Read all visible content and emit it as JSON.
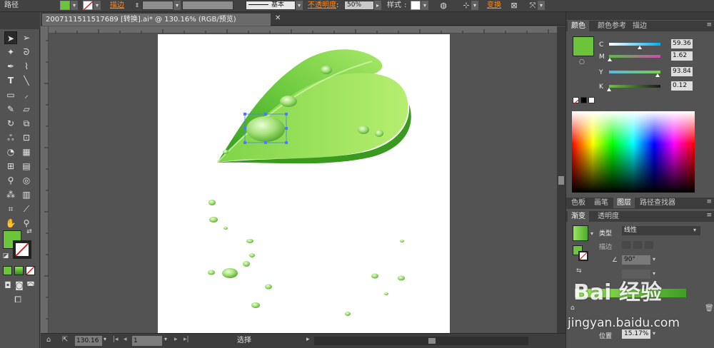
{
  "control_bar": {
    "object_type": "路径",
    "fill_color": "#6cc43a",
    "stroke_label": "描边",
    "brush_label": "基本",
    "opacity_label": "不透明度",
    "opacity_value": "50%",
    "style_label": "样式",
    "transform_label": "变换"
  },
  "document": {
    "tab_title": "2007111511517689 [转换].ai* @ 130.16% (RGB/预览)",
    "zoom_value": "130.16",
    "page_value": "1",
    "status_mode": "选择"
  },
  "color_panel": {
    "tabs": [
      "颜色",
      "颜色参考",
      "描边"
    ],
    "channels": [
      {
        "label": "C",
        "value": "59.36",
        "fraction": 0.594
      },
      {
        "label": "M",
        "value": "1.62",
        "fraction": 0.016
      },
      {
        "label": "Y",
        "value": "93.84",
        "fraction": 0.938
      },
      {
        "label": "K",
        "value": "0.12",
        "fraction": 0.001
      }
    ],
    "current_color": "#6cc43a"
  },
  "layers_tabs": [
    "色板",
    "画笔",
    "图层",
    "路径查找器"
  ],
  "gradient_panel": {
    "tabs": [
      "渐变",
      "透明度"
    ],
    "type_label": "类型",
    "type_value": "线性",
    "stroke_label": "描边",
    "angle_value": "90°",
    "location_label": "位置",
    "location_value": "15.17%"
  },
  "watermark": {
    "text": "Bai 经验",
    "url": "jingyan.baidu.com"
  },
  "icons": [
    "selection-tool-icon",
    "direct-selection-icon",
    "pen-icon",
    "type-icon",
    "zoom-icon",
    "hand-icon"
  ]
}
